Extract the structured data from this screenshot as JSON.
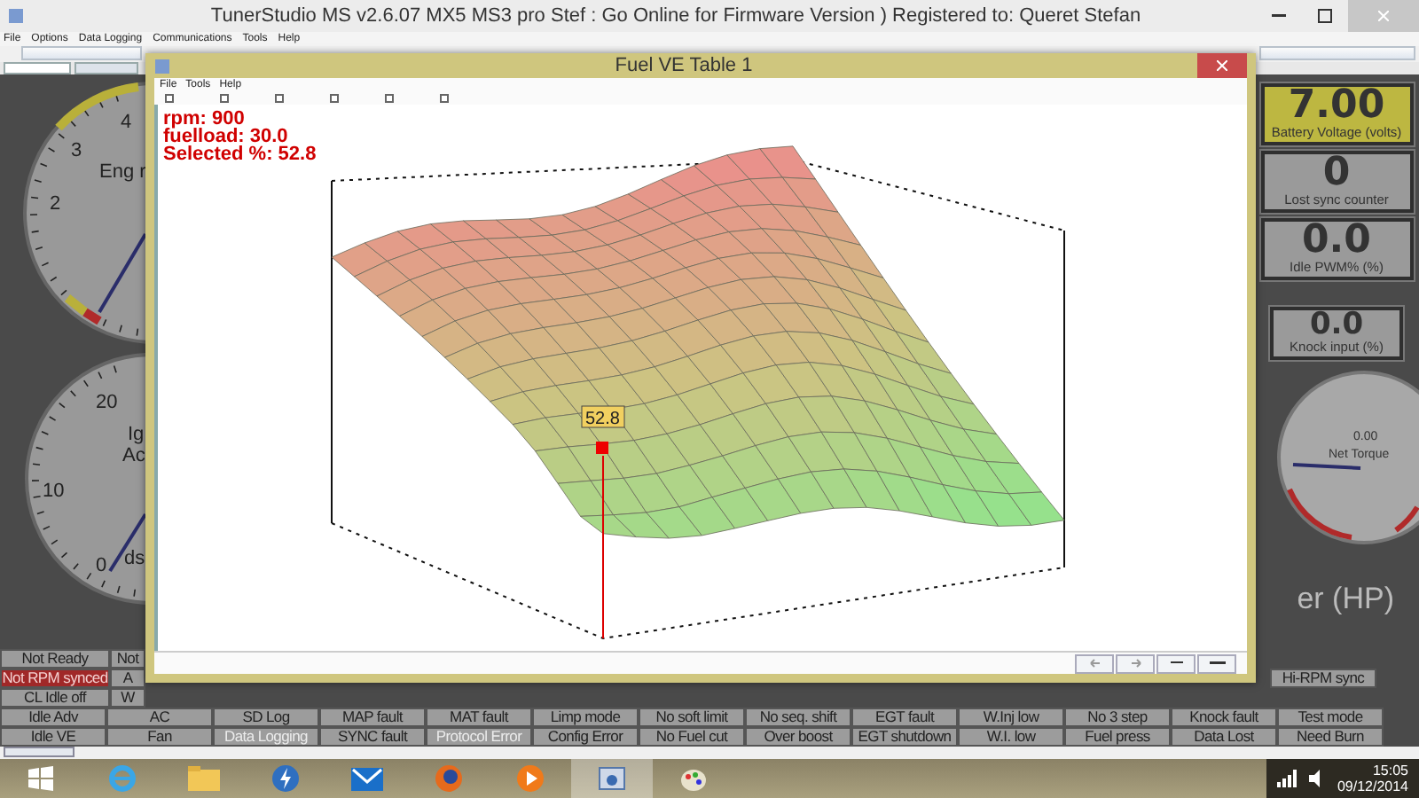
{
  "app_window": {
    "title": "TunerStudio MS v2.6.07    MX5 MS3 pro Stef : Go Online for Firmware Version ) Registered to: Queret Stefan"
  },
  "menu": [
    "File",
    "Options",
    "Data Logging",
    "Communications",
    "Tools",
    "Help"
  ],
  "gauges": [
    {
      "title": "Eng r",
      "ticks": [
        "4",
        "3",
        "2"
      ]
    },
    {
      "title": "Ig",
      "subtitle": "Ac",
      "unit": "ds",
      "ticks": [
        "20",
        "10",
        "0"
      ]
    }
  ],
  "readouts": [
    {
      "value": "7.00",
      "label": "Battery Voltage (volts)",
      "warning": true
    },
    {
      "value": "0",
      "label": "Lost sync counter",
      "warning": false
    },
    {
      "value": "0.0",
      "label": "Idle PWM% (%)",
      "warning": false
    },
    {
      "value": "0.0",
      "label": "Knock input (%)",
      "warning": false
    }
  ],
  "torque_gauge": {
    "value": "0.00",
    "label": "Net Torque"
  },
  "hp_gauge": {
    "label": "er (HP)"
  },
  "ve_window": {
    "title": "Fuel VE Table 1",
    "menu": [
      "File",
      "Tools",
      "Help"
    ],
    "readout": [
      "rpm: 900",
      "fuelload: 30.0",
      "Selected %: 52.8"
    ],
    "point_label": "52.8"
  },
  "indicators": {
    "upper_rows": [
      {
        "cells": [
          {
            "label": "Not Ready",
            "alert": false,
            "disabled": false
          },
          {
            "label": "Not",
            "alert": false,
            "disabled": false
          }
        ]
      },
      {
        "cells": [
          {
            "label": "Not RPM synced",
            "alert": true,
            "disabled": false
          },
          {
            "label": "A",
            "alert": false,
            "disabled": false
          }
        ],
        "right": {
          "label": "Hi-RPM sync",
          "alert": false,
          "disabled": false
        }
      },
      {
        "cells": [
          {
            "label": "CL Idle off",
            "alert": false,
            "disabled": false
          },
          {
            "label": "W",
            "alert": false,
            "disabled": false
          }
        ]
      }
    ],
    "rows": [
      {
        "cells": [
          {
            "label": "Idle Adv",
            "alert": false,
            "disabled": false
          },
          {
            "label": "AC",
            "alert": false,
            "disabled": false
          },
          {
            "label": "SD Log",
            "alert": false,
            "disabled": false
          },
          {
            "label": "MAP fault",
            "alert": false,
            "disabled": false
          },
          {
            "label": "MAT fault",
            "alert": false,
            "disabled": false
          },
          {
            "label": "Limp mode",
            "alert": false,
            "disabled": false
          },
          {
            "label": "No soft limit",
            "alert": false,
            "disabled": false
          },
          {
            "label": "No seq. shift",
            "alert": false,
            "disabled": false
          },
          {
            "label": "EGT fault",
            "alert": false,
            "disabled": false
          },
          {
            "label": "W.Inj low",
            "alert": false,
            "disabled": false
          },
          {
            "label": "No 3 step",
            "alert": false,
            "disabled": false
          },
          {
            "label": "Knock fault",
            "alert": false,
            "disabled": false
          },
          {
            "label": "Test mode",
            "alert": false,
            "disabled": false
          }
        ]
      },
      {
        "cells": [
          {
            "label": "Idle VE",
            "alert": false,
            "disabled": false
          },
          {
            "label": "Fan",
            "alert": false,
            "disabled": false
          },
          {
            "label": "Data Logging",
            "alert": false,
            "disabled": true
          },
          {
            "label": "SYNC fault",
            "alert": false,
            "disabled": false
          },
          {
            "label": "Protocol Error",
            "alert": false,
            "disabled": true
          },
          {
            "label": "Config Error",
            "alert": false,
            "disabled": false
          },
          {
            "label": "No Fuel cut",
            "alert": false,
            "disabled": false
          },
          {
            "label": "Over boost",
            "alert": false,
            "disabled": false
          },
          {
            "label": "EGT shutdown",
            "alert": false,
            "disabled": false
          },
          {
            "label": "W.I. low",
            "alert": false,
            "disabled": false
          },
          {
            "label": "Fuel press",
            "alert": false,
            "disabled": false
          },
          {
            "label": "Data Lost",
            "alert": false,
            "disabled": false
          },
          {
            "label": "Need Burn",
            "alert": false,
            "disabled": false
          }
        ]
      }
    ]
  },
  "taskbar": {
    "apps": [
      {
        "kind": "ie",
        "selected": false
      },
      {
        "kind": "folder",
        "selected": false
      },
      {
        "kind": "bolt",
        "selected": false
      },
      {
        "kind": "mail",
        "selected": false
      },
      {
        "kind": "firefox",
        "selected": false
      },
      {
        "kind": "media",
        "selected": false
      },
      {
        "kind": "tuner",
        "selected": true
      },
      {
        "kind": "paint",
        "selected": false
      }
    ]
  },
  "clock": {
    "time": "15:05",
    "date": "09/12/2014"
  }
}
